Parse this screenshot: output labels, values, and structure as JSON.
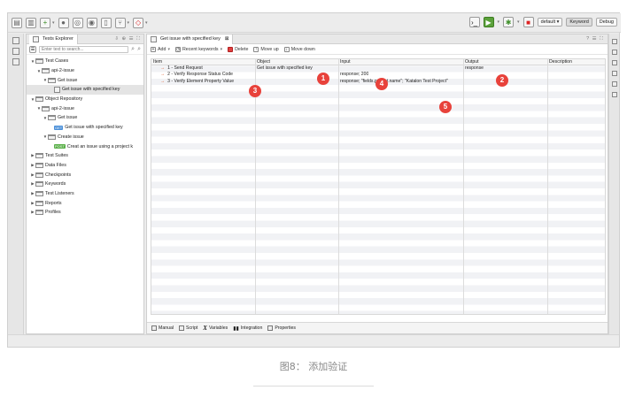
{
  "toolbar": {
    "run_config": "default",
    "perspectives": [
      "Keyword",
      "Debug"
    ]
  },
  "explorer": {
    "title": "Tests Explorer",
    "search_placeholder": "Enter text to search...",
    "tree": [
      {
        "label": "Test Cases",
        "level": 0,
        "kind": "folder",
        "expanded": true
      },
      {
        "label": "api-2-issue",
        "level": 1,
        "kind": "folder",
        "expanded": true
      },
      {
        "label": "Get issue",
        "level": 2,
        "kind": "folder",
        "expanded": true
      },
      {
        "label": "Get issue with specified key",
        "level": 3,
        "kind": "testcase",
        "selected": true
      },
      {
        "label": "Object Repository",
        "level": 0,
        "kind": "folder",
        "expanded": true
      },
      {
        "label": "api-2-issue",
        "level": 1,
        "kind": "folder",
        "expanded": true
      },
      {
        "label": "Get issue",
        "level": 2,
        "kind": "folder",
        "expanded": true
      },
      {
        "label": "Get issue with specified key",
        "level": 3,
        "kind": "api-get"
      },
      {
        "label": "Create issue",
        "level": 2,
        "kind": "folder",
        "expanded": true
      },
      {
        "label": "Creat an issue using a project k",
        "level": 3,
        "kind": "api-post"
      },
      {
        "label": "Test Suites",
        "level": 0,
        "kind": "folder",
        "expanded": false
      },
      {
        "label": "Data Files",
        "level": 0,
        "kind": "folder",
        "expanded": false
      },
      {
        "label": "Checkpoints",
        "level": 0,
        "kind": "folder",
        "expanded": false
      },
      {
        "label": "Keywords",
        "level": 0,
        "kind": "folder",
        "expanded": false
      },
      {
        "label": "Test Listeners",
        "level": 0,
        "kind": "folder",
        "expanded": false
      },
      {
        "label": "Reports",
        "level": 0,
        "kind": "folder",
        "expanded": false
      },
      {
        "label": "Profiles",
        "level": 0,
        "kind": "folder",
        "expanded": false
      }
    ],
    "api_badges": {
      "get": "GET",
      "post": "POST"
    }
  },
  "editor": {
    "tab_title": "Get issue with specified key",
    "actions": {
      "add": "Add",
      "recent": "Recent keywords",
      "delete": "Delete",
      "move_up": "Move up",
      "move_down": "Move down"
    },
    "columns": [
      "Item",
      "Object",
      "Input",
      "Output",
      "Description"
    ],
    "rows": [
      {
        "item": "1 - Send Request",
        "object": "Get issue with specified key",
        "input": "",
        "output": "response",
        "description": ""
      },
      {
        "item": "2 - Verify Response Status Code",
        "object": "",
        "input": "response; 200",
        "output": "",
        "description": ""
      },
      {
        "item": "3 - Verify Element Property Value",
        "object": "",
        "input": "response; \"fields.project.name\"; \"Katalon Test Project\"",
        "output": "",
        "description": ""
      }
    ],
    "badges": [
      "1",
      "2",
      "3",
      "4",
      "5"
    ],
    "bottom_tabs": [
      "Manual",
      "Script",
      "Variables",
      "Integration",
      "Properties"
    ]
  },
  "caption": "图8： 添加验证"
}
